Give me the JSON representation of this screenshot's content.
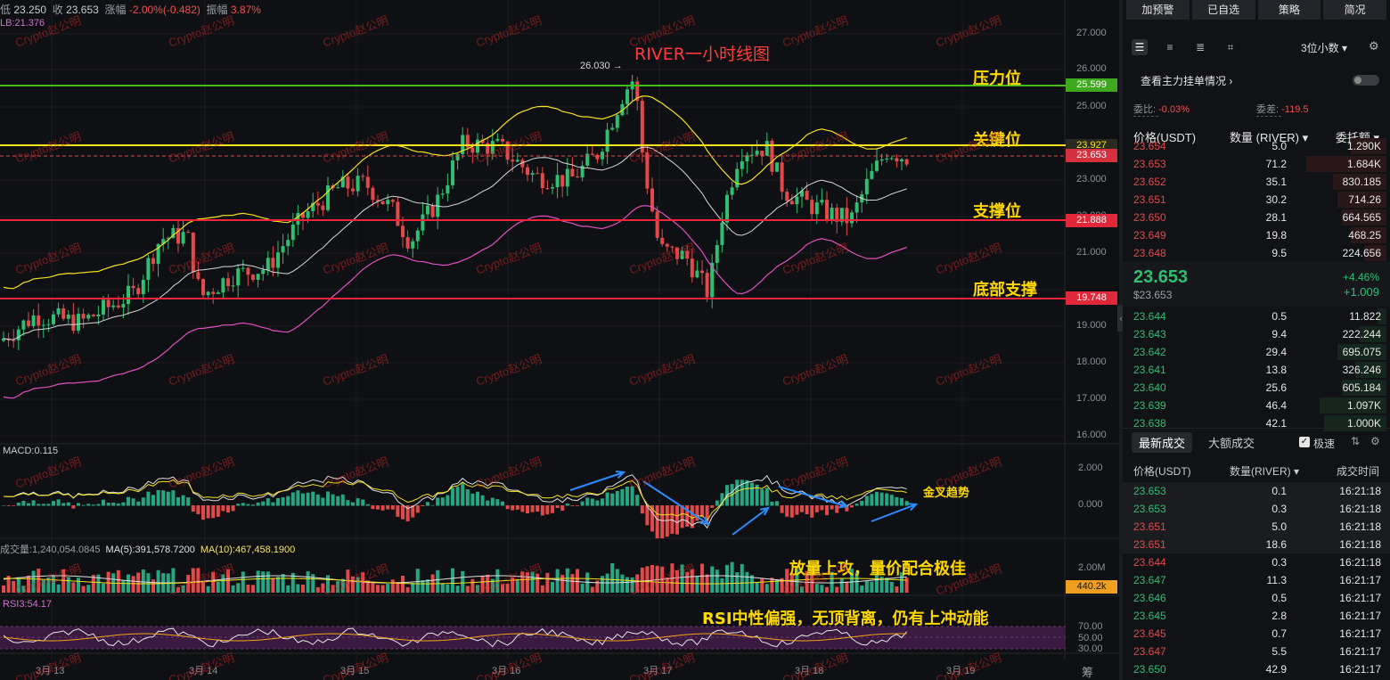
{
  "header": {
    "low_label": "低",
    "low_value": "23.250",
    "close_label": "收",
    "close_value": "23.653",
    "change_label": "涨幅",
    "change_value": "-2.00%(-0.482)",
    "amplitude_label": "振幅",
    "amplitude_value": "3.87%",
    "lb_label": "LB:21.376"
  },
  "title": "RIVER一小时线图",
  "peak_label": "26.030 →",
  "annotations": {
    "resistance": "压力位",
    "key": "关键位",
    "support": "支撑位",
    "bottom": "底部支撑",
    "golden_cross": "金叉趋势",
    "volume": "放量上攻，量价配合极佳",
    "rsi": "RSI中性偏强，无顶背离，仍有上冲动能"
  },
  "levels": {
    "resistance": "25.599",
    "key": "23.927",
    "current": "23.653",
    "support": "21.888",
    "bottom": "19.748"
  },
  "price_axis": [
    "27.000",
    "26.000",
    "25.000",
    "23.000",
    "22.000",
    "21.000",
    "19.000",
    "18.000",
    "17.000",
    "16.000"
  ],
  "macd": {
    "label": "MACD:0.115",
    "ticks": [
      "2.000",
      "0.000"
    ]
  },
  "volume": {
    "label": "成交量:1,240,054.0845",
    "ma5": "MA(5):391,578.7200",
    "ma10": "MA(10):467,458.1900",
    "tick": "2.00M",
    "current_tag": "440.2k"
  },
  "rsi": {
    "label": "RSI3:54.17",
    "ticks": [
      "70.00",
      "50.00",
      "30.00"
    ]
  },
  "dates": [
    "3月 13",
    "3月 14",
    "3月 15",
    "3月 16",
    "3月 17",
    "3月 18",
    "3月 19"
  ],
  "bottom_icons": "筹 爆",
  "watermark": "Crypto赵公明",
  "colors": {
    "up": "#2fbf71",
    "down": "#e24a4a",
    "resistance_line": "#3fbf1f",
    "key_line": "#f4e21c",
    "support_line": "#f0243a",
    "annotation": "#ffd800"
  },
  "panel": {
    "buttons": [
      "加预警",
      "已自选",
      "策略",
      "简况"
    ],
    "decimals": "3位小数 ▾",
    "orders_title": "查看主力挂单情况 ›",
    "ratio_label": "委比:",
    "ratio_value": "-0.03%",
    "diff_label": "委差:",
    "diff_value": "-119.5",
    "col_price": "价格(USDT)",
    "col_qty": "数量 (RIVER) ▾",
    "col_total": "委托额 ▾",
    "asks": [
      {
        "p": "23.654",
        "q": "5.0",
        "t": "1.290K",
        "w": 40
      },
      {
        "p": "23.653",
        "q": "71.2",
        "t": "1.684K",
        "w": 90
      },
      {
        "p": "23.652",
        "q": "35.1",
        "t": "830.185",
        "w": 60
      },
      {
        "p": "23.651",
        "q": "30.2",
        "t": "714.26",
        "w": 55
      },
      {
        "p": "23.650",
        "q": "28.1",
        "t": "664.565",
        "w": 50
      },
      {
        "p": "23.649",
        "q": "19.8",
        "t": "468.25",
        "w": 40
      },
      {
        "p": "23.648",
        "q": "9.5",
        "t": "224.656",
        "w": 25
      }
    ],
    "last_price": "23.653",
    "last_usd": "$23.653",
    "last_pct": "+4.46%",
    "last_chg": "+1.009",
    "bids": [
      {
        "p": "23.644",
        "q": "0.5",
        "t": "11.822",
        "w": 10
      },
      {
        "p": "23.643",
        "q": "9.4",
        "t": "222.244",
        "w": 30
      },
      {
        "p": "23.642",
        "q": "29.4",
        "t": "695.075",
        "w": 55
      },
      {
        "p": "23.641",
        "q": "13.8",
        "t": "326.246",
        "w": 35
      },
      {
        "p": "23.640",
        "q": "25.6",
        "t": "605.184",
        "w": 50
      },
      {
        "p": "23.639",
        "q": "46.4",
        "t": "1.097K",
        "w": 75
      },
      {
        "p": "23.638",
        "q": "42.1",
        "t": "1.000K",
        "w": 70
      }
    ],
    "tab_latest": "最新成交",
    "tab_large": "大额成交",
    "fast_label": "极速",
    "th_price": "价格(USDT)",
    "th_qty": "数量(RIVER) ▾",
    "th_time": "成交时间",
    "trades": [
      {
        "p": "23.653",
        "q": "0.1",
        "t": "16:21:18",
        "s": "buy"
      },
      {
        "p": "23.653",
        "q": "0.3",
        "t": "16:21:18",
        "s": "buy"
      },
      {
        "p": "23.651",
        "q": "5.0",
        "t": "16:21:18",
        "s": "sell"
      },
      {
        "p": "23.651",
        "q": "18.6",
        "t": "16:21:18",
        "s": "sell"
      },
      {
        "p": "23.644",
        "q": "0.3",
        "t": "16:21:18",
        "s": "sell"
      },
      {
        "p": "23.647",
        "q": "11.3",
        "t": "16:21:17",
        "s": "buy"
      },
      {
        "p": "23.646",
        "q": "0.5",
        "t": "16:21:17",
        "s": "buy"
      },
      {
        "p": "23.645",
        "q": "2.8",
        "t": "16:21:17",
        "s": "buy"
      },
      {
        "p": "23.645",
        "q": "0.7",
        "t": "16:21:17",
        "s": "sell"
      },
      {
        "p": "23.647",
        "q": "5.5",
        "t": "16:21:17",
        "s": "sell"
      },
      {
        "p": "23.650",
        "q": "42.9",
        "t": "16:21:17",
        "s": "buy"
      }
    ]
  }
}
